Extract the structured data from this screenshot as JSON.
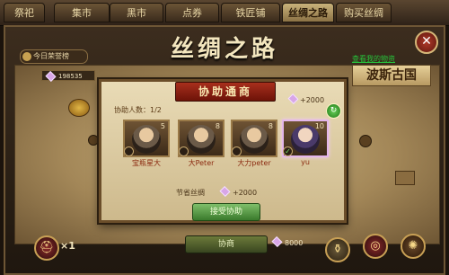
{
  "tabs": [
    "祭祀",
    "集市",
    "黑市",
    "点券",
    "铁匠铺",
    "丝绸之路",
    "购买丝绸"
  ],
  "active_tab": "丝绸之路",
  "window": {
    "title": "丝绸之路",
    "close": "✕"
  },
  "today_button": "今日荣誉榜",
  "silk_count": "198535",
  "right_link": "查看我的物资",
  "destination_country": "波斯古国",
  "dialog": {
    "title": "协助通商",
    "cost": "2000",
    "helpers_label": "协助人数：1/2",
    "candidates": [
      {
        "level": "5",
        "name": "宝瓶星大",
        "selected": false
      },
      {
        "level": "8",
        "name": "大Peter",
        "selected": false
      },
      {
        "level": "8",
        "name": "大力peter",
        "selected": false
      },
      {
        "level": "10",
        "name": "yu",
        "selected": true
      }
    ],
    "save_label": "节省丝绸",
    "save_value": "+2000",
    "accept_button": "接受协助",
    "close_icon": "↻"
  },
  "bottom": {
    "bar_label": "协商",
    "resource_value": "8000",
    "item_count": "×1"
  },
  "colors": {
    "accent": "#c9b27a",
    "dialog_title": "#a82f1d",
    "button_green": "#3a7a2c"
  }
}
